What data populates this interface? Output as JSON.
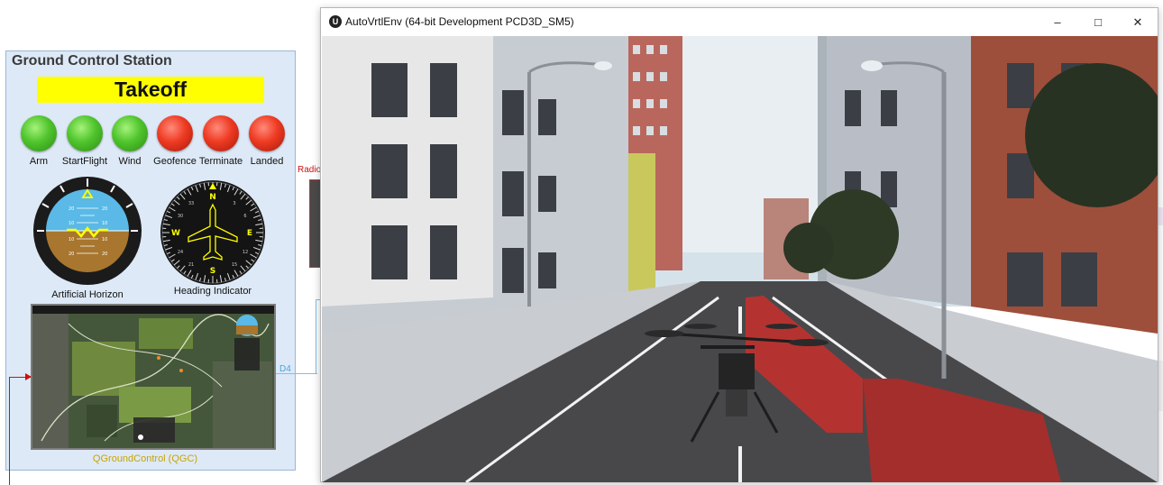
{
  "gcs": {
    "title": "Ground Control Station",
    "flight_mode": "Takeoff",
    "status_lights": [
      {
        "label": "Arm",
        "state": "green"
      },
      {
        "label": "StartFlight",
        "state": "green"
      },
      {
        "label": "Wind",
        "state": "green"
      },
      {
        "label": "Geofence",
        "state": "red"
      },
      {
        "label": "Terminate",
        "state": "red"
      },
      {
        "label": "Landed",
        "state": "red"
      }
    ],
    "artificial_horizon_label": "Artificial Horizon",
    "heading_indicator_label": "Heading Indicator",
    "qgc_label": "QGroundControl (QGC)"
  },
  "connectors": {
    "radio_label": "Radio",
    "d4_label": "D4"
  },
  "window": {
    "title": "AutoVrtlEnv (64-bit Development PCD3D_SM5)",
    "minimize_icon": "minimize-icon",
    "maximize_icon": "maximize-icon",
    "close_icon": "close-icon"
  },
  "colors": {
    "takeoff_banner": "#ffff00",
    "gcs_background": "#dde9f7",
    "status_ok": "#4fc42c",
    "status_off": "#ee3a22",
    "qgc_label": "#c9a400",
    "radio_line": "#cc1111",
    "d4_line": "#7fc0ea"
  }
}
